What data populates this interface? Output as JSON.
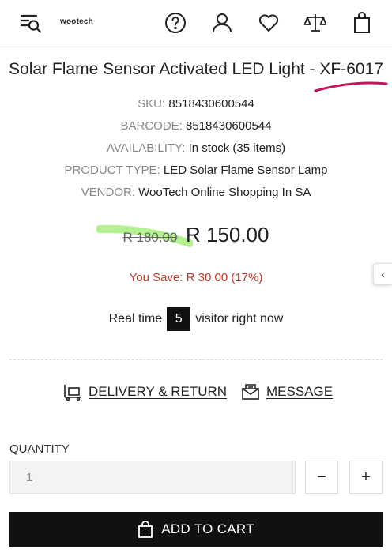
{
  "header": {
    "logo_text": "wootech",
    "icons": [
      "menu-search-icon",
      "help-icon",
      "account-icon",
      "wishlist-icon",
      "compare-icon",
      "cart-icon"
    ]
  },
  "product": {
    "title": "Solar Flame Sensor Activated LED Light - XF-6017",
    "meta": [
      {
        "key": "SKU:",
        "value": "8518430600544"
      },
      {
        "key": "BARCODE:",
        "value": "8518430600544"
      },
      {
        "key": "AVAILABILITY:",
        "value": "In stock (35 items)"
      },
      {
        "key": "PRODUCT TYPE:",
        "value": "LED Solar Flame Sensor Lamp"
      },
      {
        "key": "VENDOR:",
        "value": "WooTech Online Shopping In SA"
      }
    ],
    "old_price": "R 180.00",
    "new_price": "R 150.00",
    "you_save": "You Save: R 30.00 (17%)"
  },
  "visitors": {
    "prefix": "Real time",
    "count": "5",
    "suffix": "visitor right now"
  },
  "links": {
    "delivery": "DELIVERY & RETURN",
    "message": "MESSAGE"
  },
  "quantity": {
    "label": "QUANTITY",
    "value": "1",
    "minus": "−",
    "plus": "+"
  },
  "cart": {
    "button_label": "ADD TO CART"
  },
  "side_tab": {
    "glyph": "‹"
  },
  "colors": {
    "accent_save": "#c0392b",
    "underline_annotation": "#c2185b",
    "highlight_annotation": "#a6f07a",
    "button_dark": "#111111"
  }
}
